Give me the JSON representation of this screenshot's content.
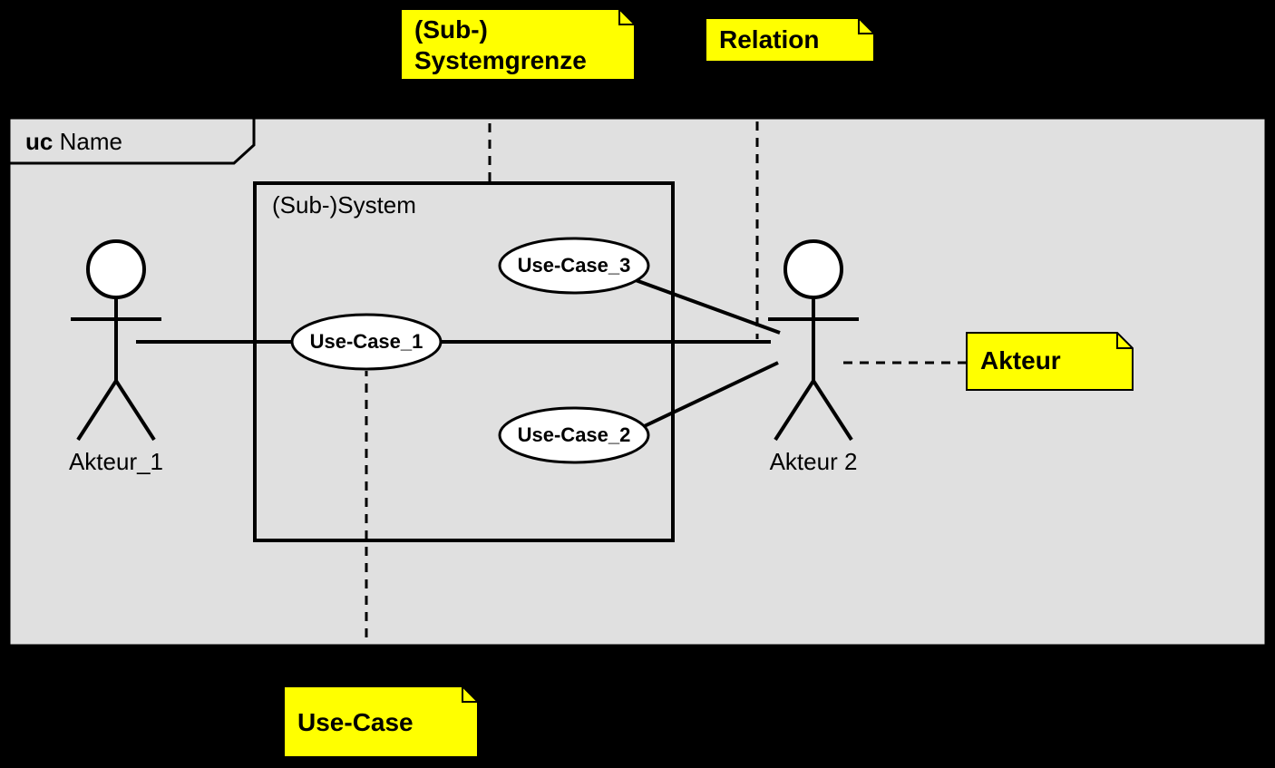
{
  "notes": {
    "systemgrenze": {
      "line1": "(Sub-)",
      "line2": "Systemgrenze"
    },
    "relation": "Relation",
    "akteur": "Akteur",
    "usecase": "Use-Case"
  },
  "frame": {
    "prefix": "uc",
    "name": "Name"
  },
  "system": {
    "label": "(Sub-)System"
  },
  "usecases": {
    "uc1": "Use-Case_1",
    "uc2": "Use-Case_2",
    "uc3": "Use-Case_3"
  },
  "actors": {
    "a1": "Akteur_1",
    "a2": "Akteur 2"
  }
}
